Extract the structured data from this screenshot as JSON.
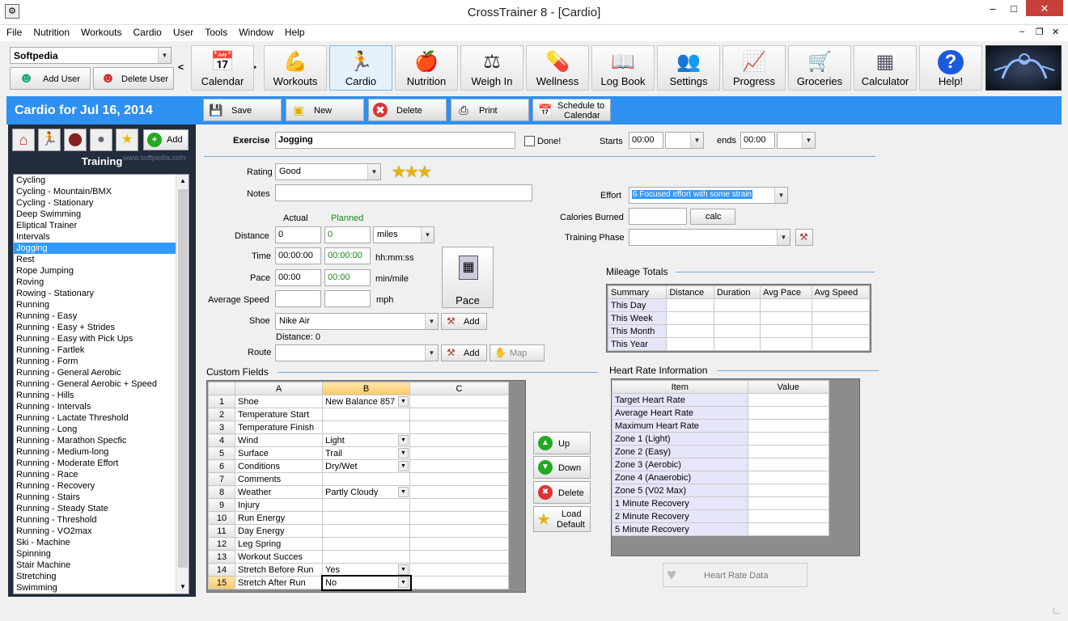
{
  "window": {
    "title": "CrossTrainer 8 - [Cardio]"
  },
  "menu": [
    "File",
    "Nutrition",
    "Workouts",
    "Cardio",
    "User",
    "Tools",
    "Window",
    "Help"
  ],
  "user": {
    "name": "Softpedia",
    "add": "Add User",
    "delete": "Delete User"
  },
  "toolbar": [
    {
      "label": "Calendar",
      "icon": "calendar-icon"
    },
    {
      "label": "Workouts",
      "icon": "dumbbell-icon"
    },
    {
      "label": "Cardio",
      "icon": "runner-icon"
    },
    {
      "label": "Nutrition",
      "icon": "apple-icon"
    },
    {
      "label": "Weigh In",
      "icon": "scale-icon"
    },
    {
      "label": "Wellness",
      "icon": "pill-icon"
    },
    {
      "label": "Log Book",
      "icon": "book-icon"
    },
    {
      "label": "Settings",
      "icon": "settings-people-icon"
    },
    {
      "label": "Progress",
      "icon": "chart-icon"
    },
    {
      "label": "Groceries",
      "icon": "cart-icon"
    },
    {
      "label": "Calculator",
      "icon": "calculator-icon"
    },
    {
      "label": "Help!",
      "icon": "help-icon"
    }
  ],
  "header": {
    "title": "Cardio for Jul 16, 2014"
  },
  "actions": {
    "save": "Save",
    "new": "New",
    "delete": "Delete",
    "print": "Print",
    "schedule1": "Schedule to",
    "schedule2": "Calendar"
  },
  "training": {
    "add": "Add",
    "title": "Training",
    "watermark": "www.softpedia.com",
    "items": [
      "Cycling",
      "Cycling - Mountain/BMX",
      "Cycling - Stationary",
      "Deep Swimming",
      "Eliptical Trainer",
      "Intervals",
      "Jogging",
      "Rest",
      "Rope Jumping",
      "Roving",
      "Rowing - Stationary",
      "Running",
      "Running - Easy",
      "Running - Easy + Strides",
      "Running - Easy with Pick Ups",
      "Running - Fartlek",
      "Running - Form",
      "Running - General Aerobic",
      "Running - General Aerobic + Speed",
      "Running - Hills",
      "Running - Intervals",
      "Running - Lactate Threshold",
      "Running - Long",
      "Running - Marathon Specfic",
      "Running - Medium-long",
      "Running - Moderate Effort",
      "Running - Race",
      "Running - Recovery",
      "Running - Stairs",
      "Running - Steady State",
      "Running - Threshold",
      "Running - VO2max",
      "Ski - Machine",
      "Spinning",
      "Stair Machine",
      "Stretching",
      "Swimming"
    ],
    "selected": "Jogging"
  },
  "form": {
    "exercise_label": "Exercise",
    "exercise": "Jogging",
    "done": "Done!",
    "starts": "Starts",
    "start_time": "00:00",
    "ends": "ends",
    "end_time": "00:00",
    "rating_label": "Rating",
    "rating": "Good",
    "notes_label": "Notes",
    "actual": "Actual",
    "planned": "Planned",
    "distance_label": "Distance",
    "distance_actual": "0",
    "distance_planned": "0",
    "distance_unit": "miles",
    "time_label": "Time",
    "time_actual": "00:00:00",
    "time_planned": "00:00:00",
    "time_unit": "hh:mm:ss",
    "pace_label": "Pace",
    "pace_actual": "00:00",
    "pace_planned": "00:00",
    "pace_unit": "min/mile",
    "speed_label": "Average Speed",
    "speed_unit": "mph",
    "pace_btn": "Pace",
    "shoe_label": "Shoe",
    "shoe": "Nike Air",
    "add": "Add",
    "shoe_distance": "Distance: 0",
    "route_label": "Route",
    "map": "Map",
    "effort_label": "Effort",
    "effort": "6 Focused effort with some strain",
    "calories_label": "Calories Burned",
    "calc": "calc",
    "phase_label": "Training Phase"
  },
  "mileage": {
    "title": "Mileage Totals",
    "cols": [
      "Summary",
      "Distance",
      "Duration",
      "Avg Pace",
      "Avg Speed"
    ],
    "rows": [
      "This Day",
      "This Week",
      "This Month",
      "This Year"
    ]
  },
  "custom": {
    "title": "Custom Fields",
    "cols": [
      "A",
      "B",
      "C"
    ],
    "rows": [
      {
        "n": "1",
        "a": "Shoe",
        "b": "New Balance 857",
        "dd": true
      },
      {
        "n": "2",
        "a": "Temperature Start",
        "b": "",
        "dd": false
      },
      {
        "n": "3",
        "a": "Temperature Finish",
        "b": "",
        "dd": false
      },
      {
        "n": "4",
        "a": "Wind",
        "b": "Light",
        "dd": true
      },
      {
        "n": "5",
        "a": "Surface",
        "b": "Trail",
        "dd": true
      },
      {
        "n": "6",
        "a": "Conditions",
        "b": "Dry/Wet",
        "dd": true
      },
      {
        "n": "7",
        "a": "Comments",
        "b": "",
        "dd": false
      },
      {
        "n": "8",
        "a": "Weather",
        "b": "Partly Cloudy",
        "dd": true
      },
      {
        "n": "9",
        "a": "Injury",
        "b": "",
        "dd": false
      },
      {
        "n": "10",
        "a": "Run Energy",
        "b": "",
        "dd": false
      },
      {
        "n": "11",
        "a": "Day Energy",
        "b": "",
        "dd": false
      },
      {
        "n": "12",
        "a": "Leg Spring",
        "b": "",
        "dd": false
      },
      {
        "n": "13",
        "a": "Workout Succes",
        "b": "",
        "dd": false
      },
      {
        "n": "14",
        "a": "Stretch Before Run",
        "b": "Yes",
        "dd": true
      },
      {
        "n": "15",
        "a": "Stretch After Run",
        "b": "No",
        "dd": true
      }
    ],
    "up": "Up",
    "down": "Down",
    "delete": "Delete",
    "load1": "Load",
    "load2": "Default"
  },
  "heart": {
    "title": "Heart Rate Information",
    "cols": [
      "Item",
      "Value"
    ],
    "rows": [
      "Target Heart Rate",
      "Average Heart Rate",
      "Maximum Heart Rate",
      "Zone 1 (Light)",
      "Zone 2 (Easy)",
      "Zone 3 (Aerobic)",
      "Zone 4 (Anaerobic)",
      "Zone 5 (V02 Max)",
      "1 Minute Recovery",
      "2 Minute Recovery",
      "5 Minute Recovery"
    ],
    "data_btn": "Heart Rate Data"
  }
}
